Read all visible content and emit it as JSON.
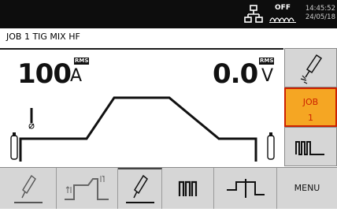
{
  "status": {
    "off_label": "OFF",
    "time": "14:45:52",
    "date": "24/05/18"
  },
  "job_line": "JOB 1  TIG  MIX  HF",
  "measurements": {
    "current_value": "100",
    "current_unit": "A",
    "current_badge": "RMS",
    "voltage_value": "0.0",
    "voltage_unit": "V",
    "voltage_badge": "RMS"
  },
  "sidebar": {
    "job_label": "JOB",
    "job_number": "1"
  },
  "bottom": {
    "menu_label": "MENU"
  },
  "colors": {
    "accent_orange": "#f5a623",
    "accent_red": "#cc2200",
    "button_gray": "#d6d6d6",
    "topbar": "#0d0d0d"
  },
  "icons": {
    "network": "network-icon",
    "arc_wave": "wave-icon",
    "torch_spark": "torch-spark-icon",
    "pulse": "pulse-wave-icon",
    "torch_weld": "torch-weld-icon",
    "slope": "slope-icon",
    "square_pulse": "square-pulse-icon",
    "waveform": "waveform-icon"
  }
}
